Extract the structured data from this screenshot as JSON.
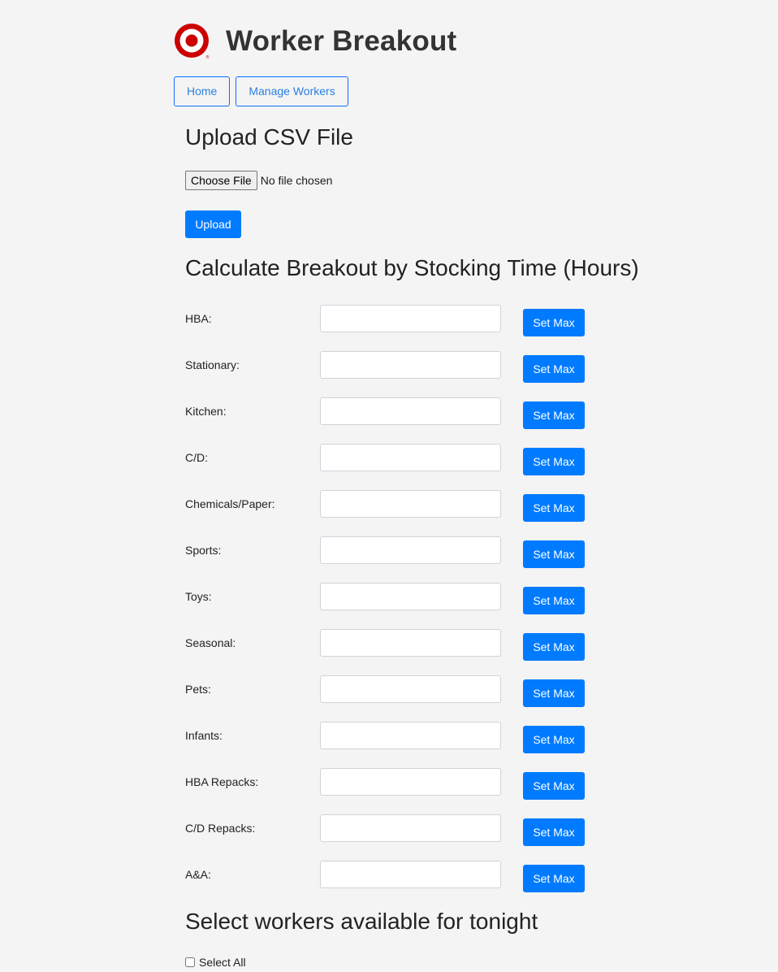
{
  "header": {
    "title": "Worker Breakout",
    "logo_icon": "target-bullseye-icon",
    "brand_color": "#cc0000"
  },
  "nav": {
    "items": [
      {
        "label": "Home"
      },
      {
        "label": "Manage Workers"
      }
    ]
  },
  "upload": {
    "heading": "Upload CSV File",
    "choose_file_label": "Choose File",
    "file_status": "No file chosen",
    "upload_label": "Upload"
  },
  "breakout": {
    "heading": "Calculate Breakout by Stocking Time (Hours)",
    "set_max_label": "Set Max",
    "categories": [
      {
        "label": "HBA:",
        "value": ""
      },
      {
        "label": "Stationary:",
        "value": ""
      },
      {
        "label": "Kitchen:",
        "value": ""
      },
      {
        "label": "C/D:",
        "value": ""
      },
      {
        "label": "Chemicals/Paper:",
        "value": ""
      },
      {
        "label": "Sports:",
        "value": ""
      },
      {
        "label": "Toys:",
        "value": ""
      },
      {
        "label": "Seasonal:",
        "value": ""
      },
      {
        "label": "Pets:",
        "value": ""
      },
      {
        "label": "Infants:",
        "value": ""
      },
      {
        "label": "HBA Repacks:",
        "value": ""
      },
      {
        "label": "C/D Repacks:",
        "value": ""
      },
      {
        "label": "A&A:",
        "value": ""
      }
    ]
  },
  "workers": {
    "heading": "Select workers available for tonight",
    "select_all_label": "Select All",
    "select_all_checked": false
  },
  "colors": {
    "accent": "#007bff",
    "background": "#f4f4f4"
  }
}
